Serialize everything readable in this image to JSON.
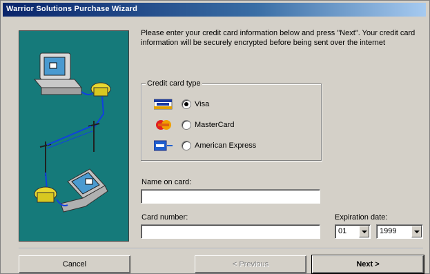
{
  "window": {
    "title": "Warrior Solutions Purchase Wizard"
  },
  "instructions": "Please enter your credit card information below and press \"Next\". Your credit card information will be securely encrypted before being sent over the internet",
  "card_type": {
    "label": "Credit card type",
    "options": [
      {
        "label": "Visa",
        "checked": true,
        "icon": "visa-card-icon"
      },
      {
        "label": "MasterCard",
        "checked": false,
        "icon": "mastercard-icon"
      },
      {
        "label": "American Express",
        "checked": false,
        "icon": "amex-card-icon"
      }
    ]
  },
  "name_on_card": {
    "label": "Name on card:",
    "value": ""
  },
  "card_number": {
    "label": "Card number:",
    "value": ""
  },
  "expiration": {
    "label": "Expiration date:",
    "month": "01",
    "year": "1999"
  },
  "buttons": {
    "cancel": "Cancel",
    "previous": "< Previous",
    "next": "Next >"
  },
  "colors": {
    "title_start": "#0a246a",
    "title_end": "#a6caf0",
    "art_bg": "#157a7a",
    "face": "#d4d0c8"
  }
}
